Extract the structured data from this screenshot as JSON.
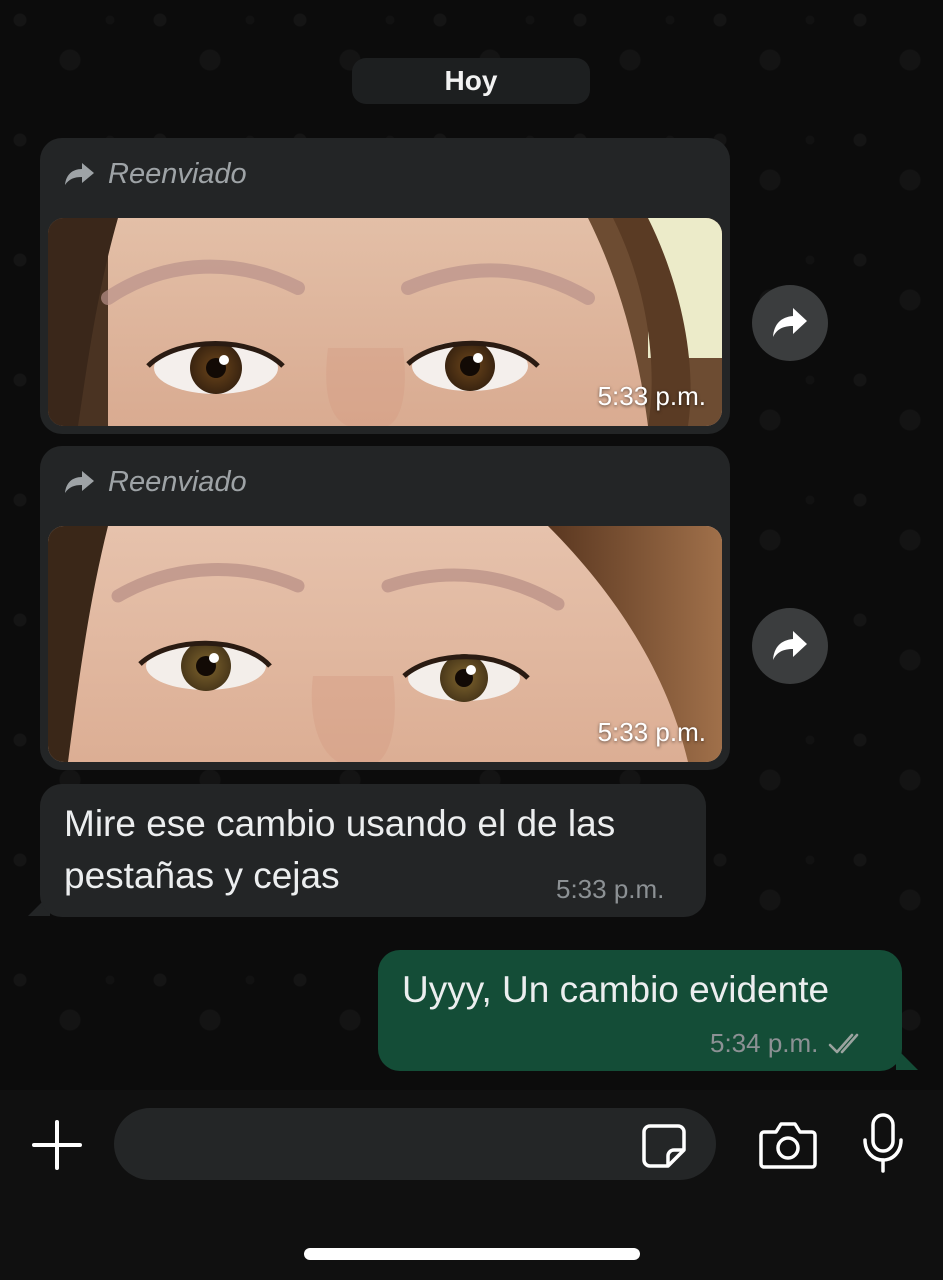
{
  "date_separator": "Hoy",
  "messages": [
    {
      "type": "image",
      "direction": "incoming",
      "forwarded_label": "Reenviado",
      "time": "5:33 p.m."
    },
    {
      "type": "image",
      "direction": "incoming",
      "forwarded_label": "Reenviado",
      "time": "5:33 p.m."
    },
    {
      "type": "text",
      "direction": "incoming",
      "text": "Mire ese cambio usando el de las pestañas y cejas",
      "time": "5:33 p.m."
    },
    {
      "type": "text",
      "direction": "outgoing",
      "text": "Uyyy, Un cambio evidente",
      "time": "5:34 p.m.",
      "status": "read"
    }
  ],
  "composer": {
    "placeholder": ""
  },
  "icons": {
    "forwarded": "forward-arrow-icon",
    "share": "share-forward-icon",
    "attach": "plus-icon",
    "sticker": "sticker-icon",
    "camera": "camera-icon",
    "mic": "microphone-icon",
    "read_receipt": "double-check-icon"
  },
  "colors": {
    "background": "#0c0c0c",
    "incoming_bubble": "#232526",
    "outgoing_bubble": "#144d37",
    "timestamp": "#8c9194"
  }
}
